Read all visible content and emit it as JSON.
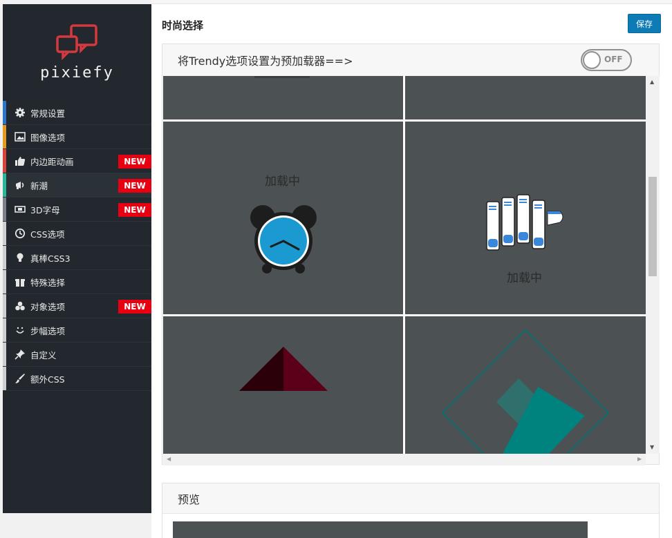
{
  "brand": {
    "name": "pixiefy",
    "logo_color": "#d6383f"
  },
  "sidebar": {
    "items": [
      {
        "label": "常规设置",
        "icon": "gear-icon",
        "bar": "#2a77c9",
        "badge": ""
      },
      {
        "label": "图像选项",
        "icon": "image-icon",
        "bar": "#e79a1a",
        "badge": ""
      },
      {
        "label": "内边距动画",
        "icon": "thumbs-up-icon",
        "bar": "#d9433b",
        "badge": "NEW"
      },
      {
        "label": "新潮",
        "icon": "megaphone-icon",
        "bar": "#27b899",
        "badge": "NEW",
        "active": true
      },
      {
        "label": "3D字母",
        "icon": "film-icon",
        "bar": "#7c8187",
        "badge": "NEW"
      },
      {
        "label": "CSS选项",
        "icon": "clock-icon",
        "bar": "#cfcfcf",
        "badge": ""
      },
      {
        "label": "真棒CSS3",
        "icon": "lightbulb-icon",
        "bar": "#cfcfcf",
        "badge": ""
      },
      {
        "label": "特殊选择",
        "icon": "gift-icon",
        "bar": "#cfcfcf",
        "badge": ""
      },
      {
        "label": "对象选项",
        "icon": "circles-icon",
        "bar": "#cfcfcf",
        "badge": "NEW"
      },
      {
        "label": "步幅选项",
        "icon": "smile-icon",
        "bar": "#cfcfcf",
        "badge": ""
      },
      {
        "label": "自定义",
        "icon": "pin-icon",
        "bar": "#cfcfcf",
        "badge": ""
      },
      {
        "label": "额外CSS",
        "icon": "brush-icon",
        "bar": "#cfcfcf",
        "badge": ""
      }
    ]
  },
  "main": {
    "title": "时尚选择",
    "save_label": "保存",
    "panel": {
      "heading": "将Trendy选项设置为预加载器==>",
      "toggle_label": "OFF",
      "toggle_on": false
    },
    "loaders": [
      {
        "name": "clock-loader",
        "text": "加载中",
        "clock_color": "#1a9ad0"
      },
      {
        "name": "servers-loader",
        "text": "加载中",
        "accent": "#3a86d8"
      },
      {
        "name": "triangle-loader",
        "colors": [
          "#2b0009",
          "#5c001a"
        ]
      },
      {
        "name": "diamond-loader",
        "color": "#00827f"
      }
    ],
    "preview": {
      "heading": "预览"
    }
  }
}
